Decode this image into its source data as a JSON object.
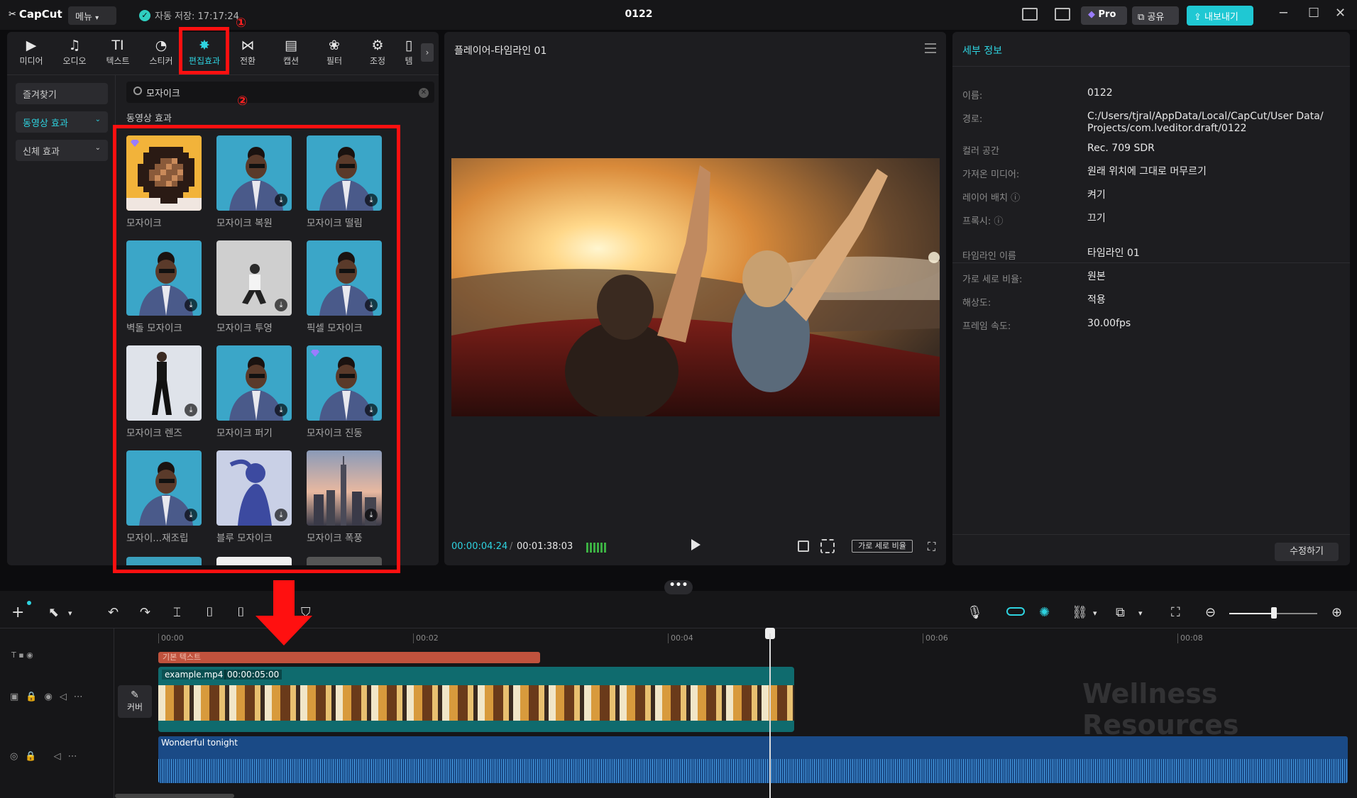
{
  "titlebar": {
    "logo": "CapCut",
    "menu_label": "메뉴",
    "autosave": "자동 저장: 17:17:24",
    "project_name": "0122",
    "pro_label": "Pro",
    "share_label": "공유",
    "export_label": "내보내기"
  },
  "tabs": [
    {
      "label": "미디어",
      "icon": "media-icon"
    },
    {
      "label": "오디오",
      "icon": "audio-icon"
    },
    {
      "label": "텍스트",
      "icon": "text-icon"
    },
    {
      "label": "스티커",
      "icon": "sticker-icon"
    },
    {
      "label": "편집효과",
      "icon": "effects-icon",
      "active": true
    },
    {
      "label": "전환",
      "icon": "transition-icon"
    },
    {
      "label": "캡션",
      "icon": "caption-icon"
    },
    {
      "label": "필터",
      "icon": "filter-icon"
    },
    {
      "label": "조정",
      "icon": "adjust-icon"
    },
    {
      "label": "템",
      "icon": "template-icon"
    }
  ],
  "categories": [
    {
      "label": "즐겨찾기"
    },
    {
      "label": "동영상 효과",
      "selected": true
    },
    {
      "label": "신체 효과"
    }
  ],
  "search": {
    "value": "모자이크"
  },
  "section_title": "동영상 효과",
  "effects": [
    {
      "label": "모자이크",
      "pro": true,
      "download": false
    },
    {
      "label": "모자이크 복원",
      "download": true
    },
    {
      "label": "모자이크 떨림",
      "download": true
    },
    {
      "label": "벽돌 모자이크",
      "download": true
    },
    {
      "label": "모자이크 투영",
      "download": true
    },
    {
      "label": "픽셀 모자이크",
      "download": true
    },
    {
      "label": "모자이크 렌즈",
      "download": true
    },
    {
      "label": "모자이크 퍼기",
      "download": true
    },
    {
      "label": "모자이크 진동",
      "pro": true,
      "download": true
    },
    {
      "label": "모자이...재조립",
      "download": true
    },
    {
      "label": "블루 모자이크",
      "download": true
    },
    {
      "label": "모자이크 폭풍",
      "download": true
    }
  ],
  "annotations": {
    "step1": "①",
    "step2": "②"
  },
  "player": {
    "title": "플레이어-타임라인 01",
    "current_time": "00:00:04:24",
    "duration": "00:01:38:03",
    "ratio_label": "가로 세로 비율"
  },
  "details": {
    "header": "세부 정보",
    "rows": [
      {
        "key": "이름:",
        "value": "0122"
      },
      {
        "key": "경로:",
        "value": "C:/Users/tjral/AppData/Local/CapCut/User Data/ Projects/com.lveditor.draft/0122"
      },
      {
        "key": "컬러 공간",
        "value": "Rec. 709 SDR"
      },
      {
        "key": "가져온 미디어:",
        "value": "원래 위치에 그대로 머무르기"
      },
      {
        "key": "레이어 배치 ⓘ",
        "value": "켜기"
      },
      {
        "key": "프록시: ⓘ",
        "value": "끄기"
      },
      {
        "key": "타임라인 이름",
        "value": "타임라인 01"
      },
      {
        "key": "가로 세로 비율:",
        "value": "원본"
      },
      {
        "key": "해상도:",
        "value": "적용"
      },
      {
        "key": "프레임 속도:",
        "value": "30.00fps"
      }
    ],
    "edit_label": "수정하기"
  },
  "timeline": {
    "ruler": [
      "00:00",
      "00:02",
      "00:04",
      "00:06",
      "00:08"
    ],
    "text_clip": "기본 텍스트",
    "video_clip_name": "example.mp4",
    "video_clip_duration": "00:00:05:00",
    "audio_clip_name": "Wonderful tonight",
    "cover_label": "커버",
    "watermark": "Wellness Resources"
  },
  "colors": {
    "accent": "#2ed3e0",
    "annotation": "#ff1010",
    "export": "#1fc8d3"
  }
}
